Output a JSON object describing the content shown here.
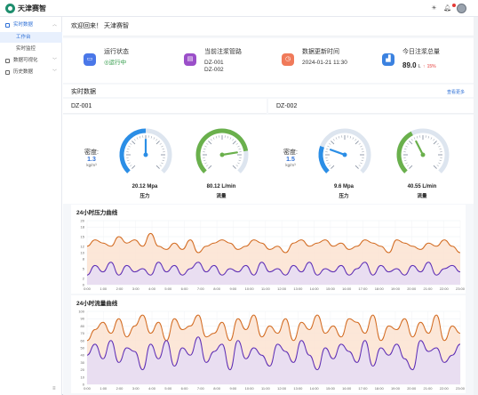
{
  "app": {
    "brand": "天津赛智"
  },
  "topbar": {
    "icons": [
      "sun-icon",
      "bell-icon",
      "gear-icon"
    ]
  },
  "sidebar": {
    "items": [
      {
        "label": "实时数据",
        "icon": "monitor-icon",
        "expanded": true
      },
      {
        "label": "数据可视化",
        "icon": "chart-icon"
      },
      {
        "label": "历史数据",
        "icon": "history-icon"
      }
    ],
    "subitems": [
      {
        "label": "工作台",
        "active": true
      },
      {
        "label": "实时监控",
        "active": false
      }
    ]
  },
  "welcome": {
    "text": "欢迎回来！ 天津赛智"
  },
  "stats": [
    {
      "title": "运行状态",
      "value": "◎运行中",
      "icon": "monitor-icon",
      "color": "#4a77e8"
    },
    {
      "title": "当前注浆管路",
      "value_lines": [
        "DZ-001",
        "DZ-002"
      ],
      "icon": "pipe-icon",
      "color": "#9b4fc9"
    },
    {
      "title": "数据更新时间",
      "value": "2024-01-21 11:30",
      "icon": "clock-icon",
      "color": "#f07a5a"
    },
    {
      "title": "今日注浆总量",
      "value": "89.0",
      "unit": "L",
      "trend": "15%",
      "icon": "chart-icon",
      "color": "#3b82e0"
    }
  ],
  "realtime": {
    "title": "实时数据",
    "more": "查看更多"
  },
  "devices": [
    {
      "name": "DZ-001",
      "density": {
        "label": "密度:",
        "value": "1.3",
        "unit": "kg/m³"
      },
      "pressure": {
        "reading": "20.12 Mpa",
        "name": "压力",
        "fraction": 0.5
      },
      "flow": {
        "reading": "80.12 L/min",
        "name": "流量",
        "fraction": 0.8
      }
    },
    {
      "name": "DZ-002",
      "density": {
        "label": "密度:",
        "value": "1.5",
        "unit": "kg/m³"
      },
      "pressure": {
        "reading": "9.6 Mpa",
        "name": "压力",
        "fraction": 0.24
      },
      "flow": {
        "reading": "40.55 L/min",
        "name": "流量",
        "fraction": 0.4
      }
    }
  ],
  "chart_data": [
    {
      "type": "area",
      "title": "24小时压力曲线",
      "ylim": [
        0,
        20
      ],
      "yticks": [
        0,
        2,
        5,
        8,
        10,
        12,
        15,
        18,
        20
      ],
      "x": [
        "0:00",
        "1:00",
        "2:00",
        "3:00",
        "4:00",
        "5:00",
        "6:00",
        "7:00",
        "8:00",
        "9:00",
        "10:00",
        "11:00",
        "12:00",
        "13:00",
        "14:00",
        "15:00",
        "16:00",
        "17:00",
        "18:00",
        "19:00",
        "20:00",
        "21:00",
        "22:00",
        "23:00"
      ],
      "series": [
        {
          "color": "#d2691e",
          "fill": "#fbe3d1",
          "values": [
            12,
            14,
            13,
            12,
            15,
            13,
            14,
            12,
            16,
            12,
            11,
            13,
            11,
            14,
            10,
            12,
            13,
            14,
            13,
            11,
            12,
            14,
            13,
            11,
            12,
            10,
            13,
            14,
            12,
            13,
            14,
            12,
            13,
            11,
            12,
            14,
            13,
            12,
            10,
            14,
            13,
            12,
            11,
            13,
            12,
            14,
            12,
            10
          ]
        },
        {
          "color": "#5b2bb5",
          "fill": "#e5dcf6",
          "values": [
            3,
            6,
            4,
            7,
            3,
            6,
            4,
            5,
            3,
            7,
            4,
            6,
            3,
            5,
            7,
            4,
            6,
            3,
            5,
            4,
            6,
            3,
            7,
            4,
            5,
            3,
            6,
            4,
            7,
            3,
            5,
            4,
            6,
            3,
            5,
            7,
            3,
            6,
            4,
            5,
            3,
            6,
            4,
            7,
            3,
            5,
            6,
            4
          ]
        }
      ],
      "grid": true
    },
    {
      "type": "area",
      "title": "24小时流量曲线",
      "ylim": [
        0,
        100
      ],
      "yticks": [
        0,
        10,
        20,
        30,
        40,
        50,
        60,
        70,
        80,
        90,
        100
      ],
      "x": [
        "0:00",
        "1:00",
        "2:00",
        "3:00",
        "4:00",
        "5:00",
        "6:00",
        "7:00",
        "8:00",
        "9:00",
        "10:00",
        "11:00",
        "12:00",
        "13:00",
        "14:00",
        "15:00",
        "16:00",
        "17:00",
        "18:00",
        "19:00",
        "20:00",
        "21:00",
        "22:00",
        "23:00"
      ],
      "series": [
        {
          "color": "#d2691e",
          "fill": "#fbe3d1",
          "values": [
            60,
            75,
            85,
            70,
            90,
            65,
            80,
            95,
            70,
            85,
            60,
            90,
            75,
            80,
            95,
            65,
            70,
            85,
            60,
            90,
            75,
            95,
            65,
            80,
            70,
            90,
            60,
            85,
            75,
            95,
            70,
            80,
            65,
            90,
            85,
            70,
            95,
            60,
            80,
            75,
            90,
            65,
            85,
            70,
            95,
            60,
            80,
            70
          ]
        },
        {
          "color": "#5b2bb5",
          "fill": "#e5dcf6",
          "values": [
            40,
            55,
            35,
            60,
            30,
            50,
            45,
            20,
            55,
            35,
            60,
            25,
            50,
            40,
            65,
            30,
            45,
            55,
            20,
            60,
            35,
            50,
            40,
            25,
            55,
            45,
            30,
            60,
            40,
            20,
            50,
            35,
            55,
            45,
            30,
            60,
            25,
            50,
            40,
            55,
            35,
            20,
            60,
            45,
            50,
            30,
            40,
            55
          ]
        }
      ],
      "grid": true
    }
  ]
}
